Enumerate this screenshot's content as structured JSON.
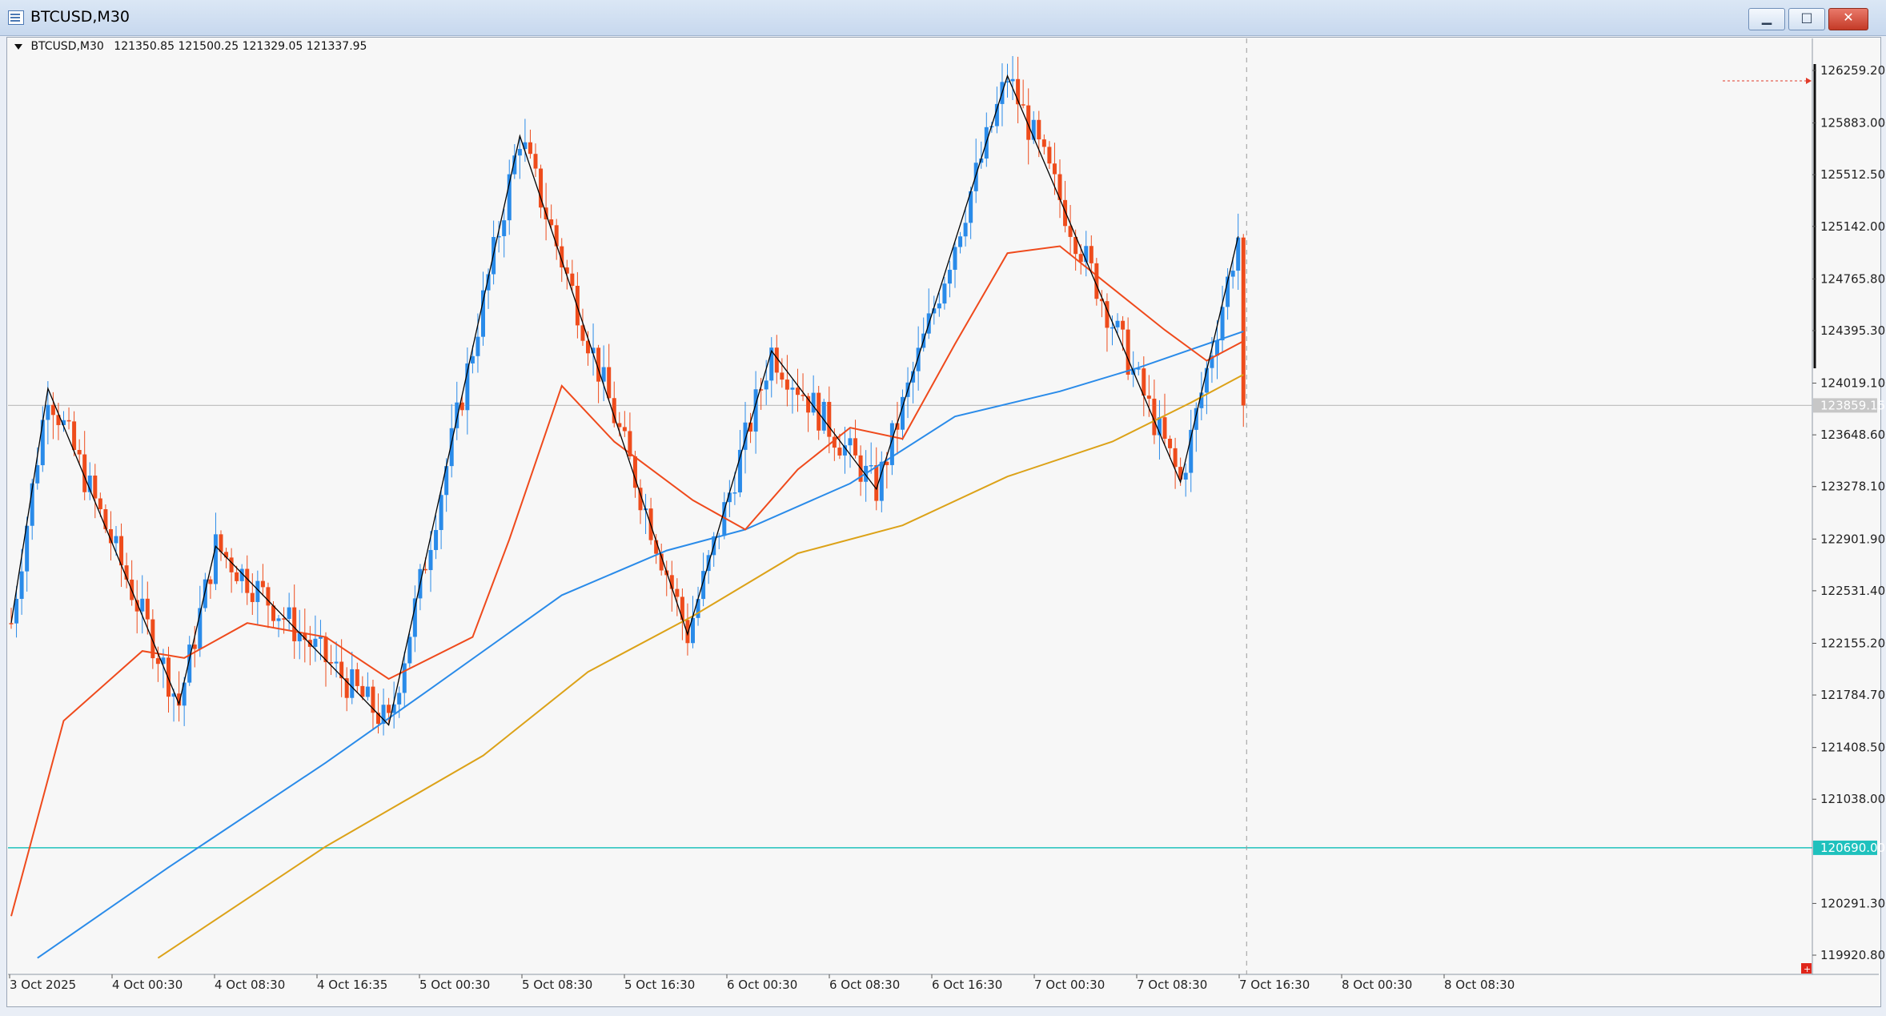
{
  "window": {
    "title": "BTCUSD,M30",
    "buttons": {
      "minimize": "▁",
      "maximize": "□",
      "close": "✕"
    }
  },
  "chart_header": {
    "symbol": "BTCUSD,M30",
    "ohlc": "121350.85 121500.25 121329.05 121337.95"
  },
  "price_scale": {
    "labels": [
      "126259.20",
      "125883.00",
      "125512.50",
      "125142.00",
      "124765.80",
      "124395.30",
      "124019.10",
      "123648.60",
      "123278.10",
      "122901.90",
      "122531.40",
      "122155.20",
      "121784.70",
      "121408.50",
      "121038.00",
      "120291.30",
      "119920.80"
    ],
    "current_price_label": "123859.15",
    "hline_label": "120690.00"
  },
  "colors": {
    "bull": "#2a8be9",
    "bear": "#ee4c1c",
    "ma_fast": "#ef4a1c",
    "ma_mid": "#2a8be9",
    "ma_slow": "#dca218",
    "hline": "#1fc1bd",
    "current_line": "#c2c2c2",
    "zigzag": "#000000"
  },
  "chart_data": {
    "type": "candlestick",
    "symbol": "BTCUSD",
    "timeframe": "M30",
    "ylim": [
      119900,
      126500
    ],
    "x_tick_labels": [
      "3 Oct 2025",
      "4 Oct 00:30",
      "4 Oct 08:30",
      "4 Oct 16:35",
      "5 Oct 00:30",
      "5 Oct 08:30",
      "5 Oct 16:30",
      "6 Oct 00:30",
      "6 Oct 08:30",
      "6 Oct 16:30",
      "7 Oct 00:30",
      "7 Oct 08:30",
      "7 Oct 16:30",
      "8 Oct 00:30",
      "8 Oct 08:30"
    ],
    "zigzag": [
      {
        "bar": 0,
        "price": 122300
      },
      {
        "bar": 7,
        "price": 123980
      },
      {
        "bar": 32,
        "price": 121720
      },
      {
        "bar": 39,
        "price": 122850
      },
      {
        "bar": 72,
        "price": 121570
      },
      {
        "bar": 97,
        "price": 125790
      },
      {
        "bar": 129,
        "price": 122220
      },
      {
        "bar": 145,
        "price": 124250
      },
      {
        "bar": 165,
        "price": 123260
      },
      {
        "bar": 190,
        "price": 126220
      },
      {
        "bar": 223,
        "price": 123310
      },
      {
        "bar": 234,
        "price": 125070
      }
    ],
    "ma_fast": [
      {
        "bar": 0,
        "price": 120200
      },
      {
        "bar": 10,
        "price": 121600
      },
      {
        "bar": 25,
        "price": 122100
      },
      {
        "bar": 33,
        "price": 122050
      },
      {
        "bar": 45,
        "price": 122300
      },
      {
        "bar": 60,
        "price": 122200
      },
      {
        "bar": 72,
        "price": 121900
      },
      {
        "bar": 88,
        "price": 122200
      },
      {
        "bar": 95,
        "price": 122900
      },
      {
        "bar": 105,
        "price": 124000
      },
      {
        "bar": 115,
        "price": 123600
      },
      {
        "bar": 130,
        "price": 123180
      },
      {
        "bar": 140,
        "price": 122970
      },
      {
        "bar": 150,
        "price": 123400
      },
      {
        "bar": 160,
        "price": 123700
      },
      {
        "bar": 170,
        "price": 123620
      },
      {
        "bar": 180,
        "price": 124300
      },
      {
        "bar": 190,
        "price": 124950
      },
      {
        "bar": 200,
        "price": 125000
      },
      {
        "bar": 210,
        "price": 124700
      },
      {
        "bar": 220,
        "price": 124400
      },
      {
        "bar": 228,
        "price": 124180
      },
      {
        "bar": 235,
        "price": 124320
      }
    ],
    "ma_mid": [
      {
        "bar": 5,
        "price": 119900
      },
      {
        "bar": 30,
        "price": 120550
      },
      {
        "bar": 60,
        "price": 121300
      },
      {
        "bar": 80,
        "price": 121830
      },
      {
        "bar": 105,
        "price": 122500
      },
      {
        "bar": 125,
        "price": 122820
      },
      {
        "bar": 140,
        "price": 122970
      },
      {
        "bar": 160,
        "price": 123300
      },
      {
        "bar": 180,
        "price": 123780
      },
      {
        "bar": 200,
        "price": 123960
      },
      {
        "bar": 215,
        "price": 124130
      },
      {
        "bar": 235,
        "price": 124390
      }
    ],
    "ma_slow": [
      {
        "bar": 28,
        "price": 119900
      },
      {
        "bar": 60,
        "price": 120700
      },
      {
        "bar": 90,
        "price": 121350
      },
      {
        "bar": 110,
        "price": 121950
      },
      {
        "bar": 130,
        "price": 122350
      },
      {
        "bar": 150,
        "price": 122800
      },
      {
        "bar": 170,
        "price": 123000
      },
      {
        "bar": 190,
        "price": 123350
      },
      {
        "bar": 210,
        "price": 123600
      },
      {
        "bar": 225,
        "price": 123880
      },
      {
        "bar": 235,
        "price": 124080
      }
    ],
    "current_price": 123859.15,
    "hline_price": 120690.0,
    "candle_count": 236
  }
}
